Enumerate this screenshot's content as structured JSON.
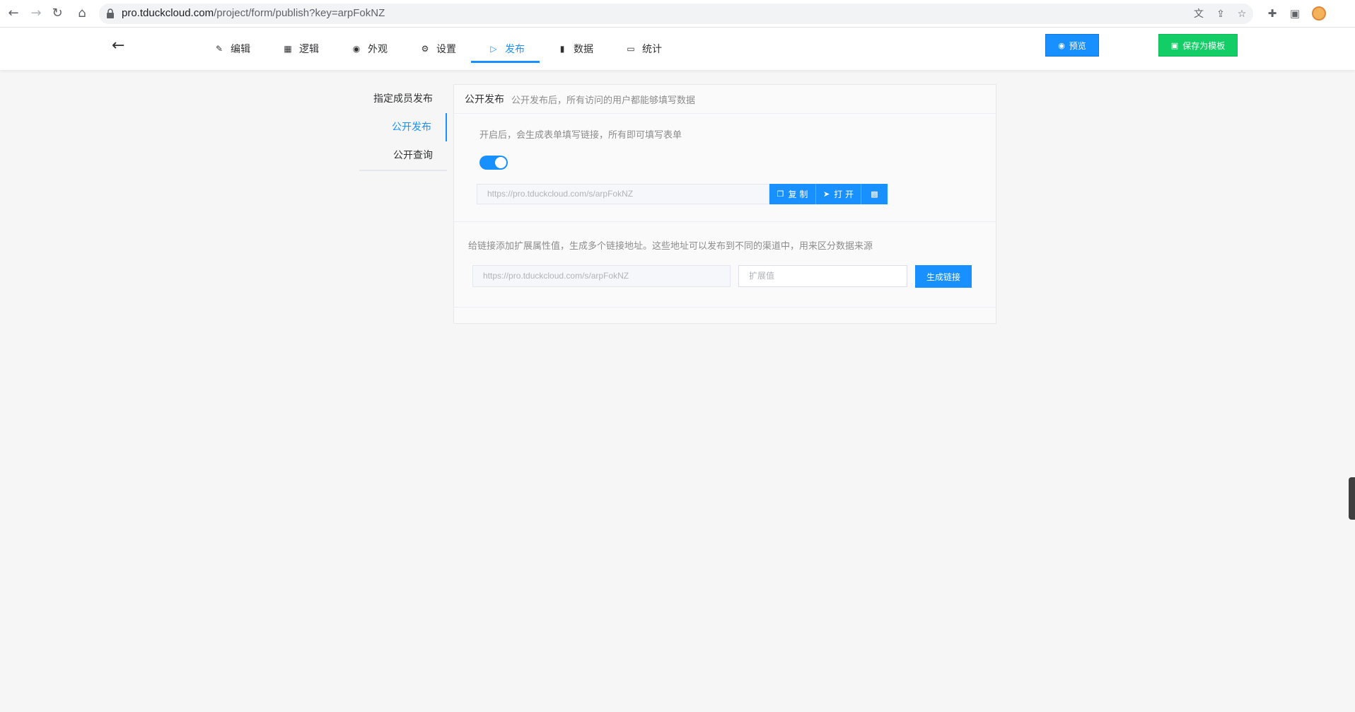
{
  "browser": {
    "url_host": "pro.tduckcloud.com",
    "url_path": "/project/form/publish?key=arpFokNZ"
  },
  "header": {
    "tabs": [
      {
        "label": "编辑",
        "icon": "pencil-icon"
      },
      {
        "label": "逻辑",
        "icon": "grid-icon"
      },
      {
        "label": "外观",
        "icon": "eye-icon"
      },
      {
        "label": "设置",
        "icon": "gear-icon"
      },
      {
        "label": "发布",
        "icon": "play-circle-icon",
        "active": true
      },
      {
        "label": "数据",
        "icon": "bar-chart-icon"
      },
      {
        "label": "统计",
        "icon": "chat-bubble-icon"
      }
    ],
    "preview_label": "预览",
    "save_template_label": "保存为模板"
  },
  "sidebar": {
    "items": [
      {
        "label": "指定成员发布"
      },
      {
        "label": "公开发布",
        "active": true
      },
      {
        "label": "公开查询"
      }
    ]
  },
  "panel": {
    "title": "公开发布",
    "subtitle": "公开发布后，所有访问的用户都能够填写数据",
    "section1": {
      "desc": "开启后，会生成表单填写链接，所有即可填写表单",
      "switch_on": true,
      "link": "https://pro.tduckcloud.com/s/arpFokNZ",
      "copy_label": "复 制",
      "open_label": "打 开"
    },
    "section2": {
      "desc": "给链接添加扩展属性值，生成多个链接地址。这些地址可以发布到不同的渠道中，用来区分数据来源",
      "link": "https://pro.tduckcloud.com/s/arpFokNZ",
      "ext_placeholder": "扩展值",
      "generate_label": "生成链接"
    }
  },
  "colors": {
    "primary": "#1890ff",
    "success": "#13ce66"
  }
}
